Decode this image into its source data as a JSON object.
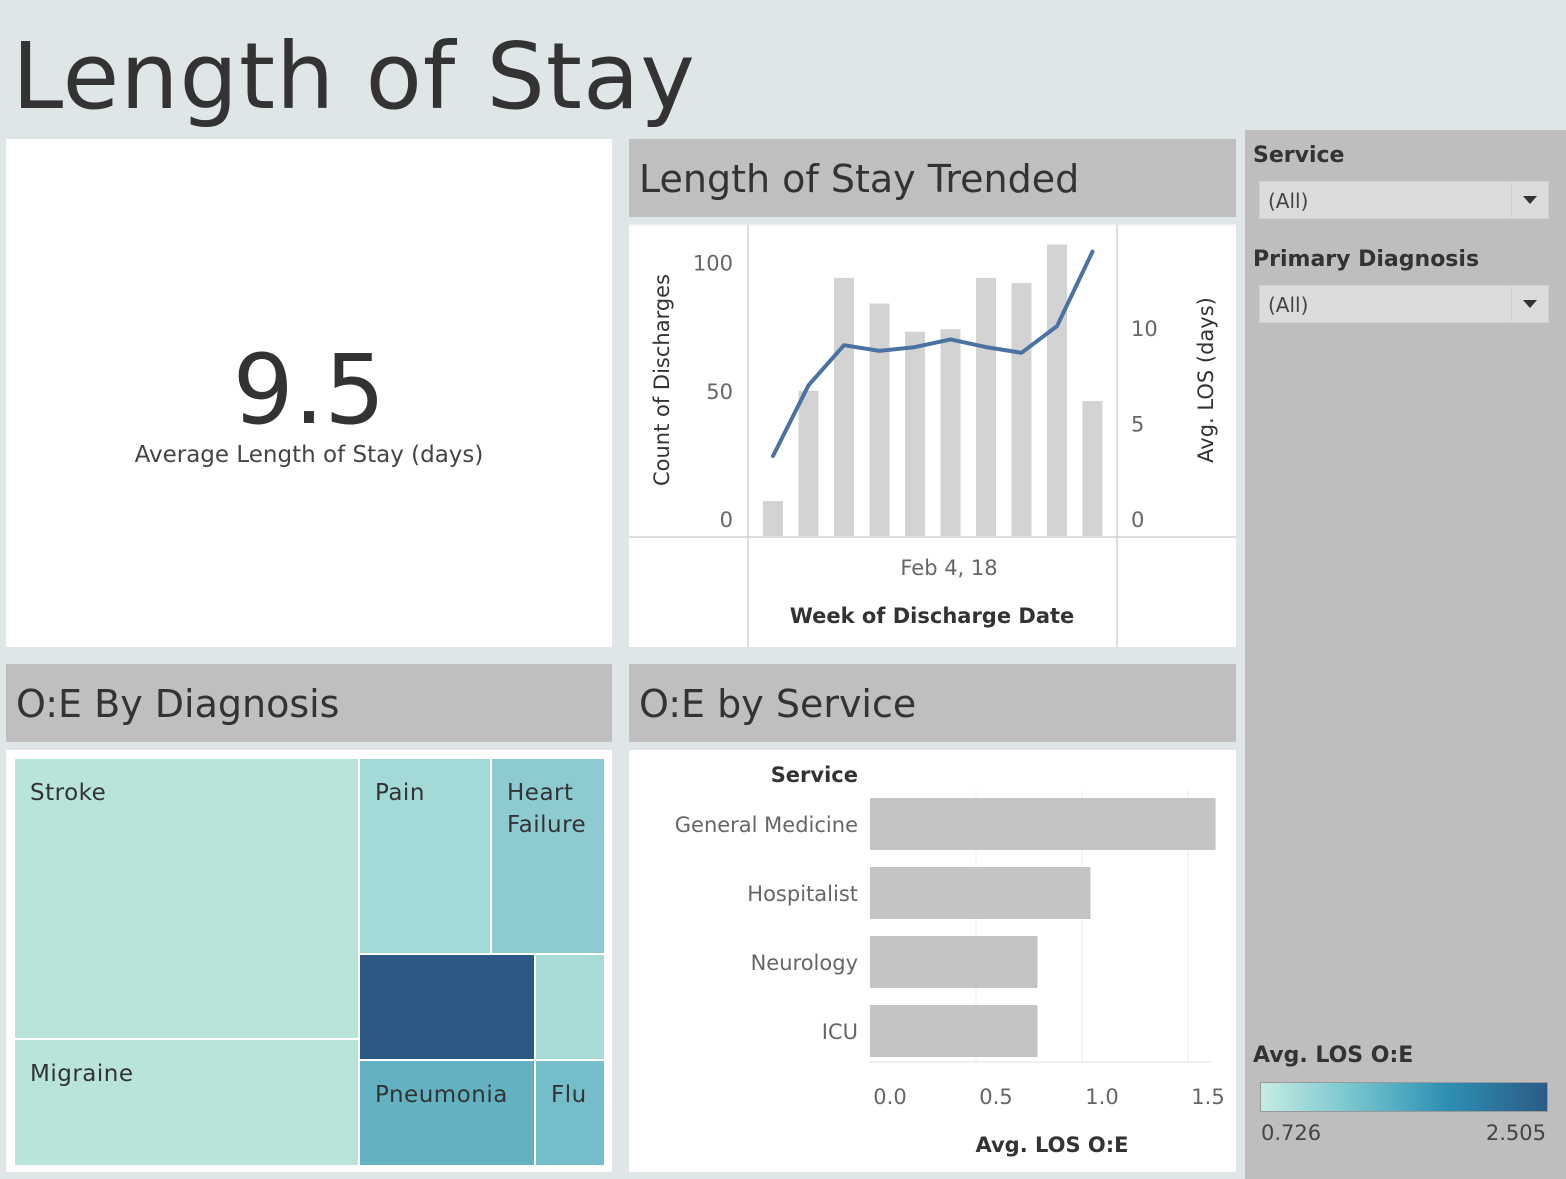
{
  "dashboard": {
    "title": "Length of Stay"
  },
  "kpi": {
    "value": "9.5",
    "label": "Average Length of Stay (days)"
  },
  "trend": {
    "header": "Length of Stay Trended",
    "y_left_label": "Count of Discharges",
    "y_right_label": "Avg. LOS (days)",
    "x_tick": "Feb 4, 18",
    "x_label": "Week of Discharge Date",
    "bar_color": "#d3d3d3",
    "line_color": "#4a72a3"
  },
  "diagnosis": {
    "header": "O:E By Diagnosis",
    "cells": [
      {
        "label": "Stroke",
        "color": "#b9e4da"
      },
      {
        "label": "Pain",
        "color": "#a3d9d7"
      },
      {
        "label": "Heart Failure",
        "color": "#8ecbd1"
      },
      {
        "label": "Migraine",
        "color": "#b9e4da"
      },
      {
        "label": "",
        "color": "#2c5985"
      },
      {
        "label": "",
        "color": "#a7dbd8"
      },
      {
        "label": "Pneumonia",
        "color": "#62b2c4"
      },
      {
        "label": "Flu",
        "color": "#74bdca"
      }
    ]
  },
  "service_chart": {
    "header": "O:E by Service",
    "row_header": "Service",
    "x_label": "Avg. LOS O:E",
    "bar_color": "#c4c4c4"
  },
  "filters": {
    "service_label": "Service",
    "service_value": "(All)",
    "diagnosis_label": "Primary Diagnosis",
    "diagnosis_value": "(All)"
  },
  "legend": {
    "title": "Avg. LOS O:E",
    "min": "0.726",
    "max": "2.505",
    "color_low": "#c6ece3",
    "color_high": "#2b5b86"
  },
  "chart_data": [
    {
      "type": "bar",
      "title": "Length of Stay Trended",
      "xlabel": "Week of Discharge Date",
      "x_tick_labels": [
        "Feb 4, 18"
      ],
      "ylabel": "Count of Discharges",
      "y2label": "Avg. LOS (days)",
      "ylim": [
        0,
        108
      ],
      "y2lim": [
        0,
        14.5
      ],
      "y_ticks": [
        0,
        50,
        100
      ],
      "y2_ticks": [
        0,
        5,
        10
      ],
      "series": [
        {
          "type": "bar",
          "values": [
            7,
            50,
            94,
            84,
            73,
            74,
            94,
            92,
            107,
            46
          ]
        },
        {
          "type": "line",
          "axis": "right",
          "values": [
            3.3,
            7.0,
            9.1,
            8.8,
            9.0,
            9.4,
            9.0,
            8.7,
            10.1,
            14.0
          ]
        }
      ]
    },
    {
      "type": "bar",
      "orientation": "horizontal",
      "title": "O:E by Service",
      "categories": [
        "General Medicine",
        "Hospitalist",
        "Neurology",
        "ICU"
      ],
      "values": [
        1.63,
        1.04,
        0.79,
        0.79
      ],
      "xlabel": "Avg. LOS O:E",
      "xlim": [
        0,
        1.75
      ],
      "x_ticks": [
        "0.0",
        "0.5",
        "1.0",
        "1.5"
      ],
      "ylabel": "Service"
    },
    {
      "type": "treemap",
      "title": "O:E By Diagnosis",
      "color_scale": {
        "title": "Avg. LOS O:E",
        "min": 0.726,
        "max": 2.505
      },
      "categories": [
        "Stroke",
        "Pain",
        "Heart Failure",
        "Migraine",
        "Pneumonia",
        "Flu"
      ]
    }
  ]
}
